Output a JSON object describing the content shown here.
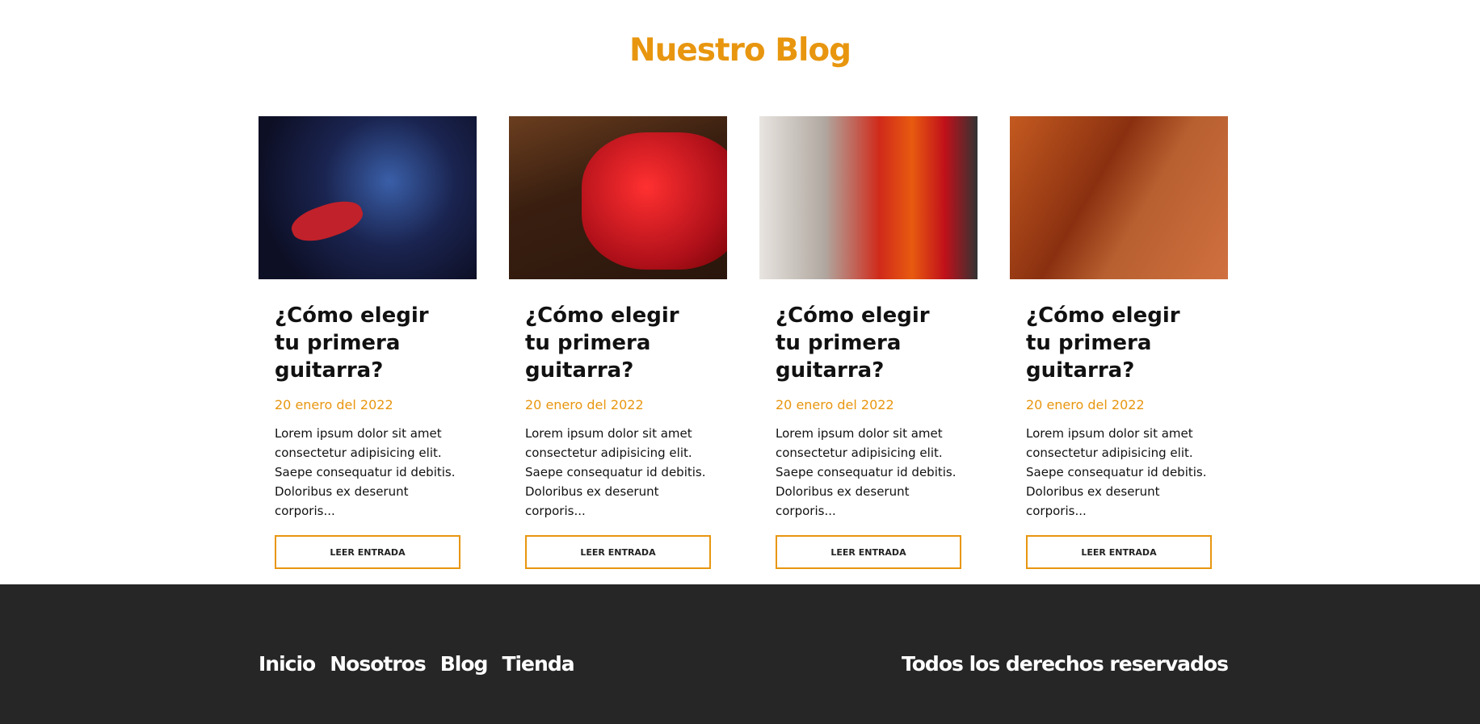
{
  "heading": "Nuestro Blog",
  "posts": [
    {
      "title": "¿Cómo elegir tu primera guitarra?",
      "date": "20 enero del 2022",
      "excerpt": "Lorem ipsum dolor sit amet consectetur adipisicing elit. Saepe consequatur id debitis. Doloribus ex deserunt corporis...",
      "button": "LEER ENTRADA"
    },
    {
      "title": "¿Cómo elegir tu primera guitarra?",
      "date": "20 enero del 2022",
      "excerpt": "Lorem ipsum dolor sit amet consectetur adipisicing elit. Saepe consequatur id debitis. Doloribus ex deserunt corporis...",
      "button": "LEER ENTRADA"
    },
    {
      "title": "¿Cómo elegir tu primera guitarra?",
      "date": "20 enero del 2022",
      "excerpt": "Lorem ipsum dolor sit amet consectetur adipisicing elit. Saepe consequatur id debitis. Doloribus ex deserunt corporis...",
      "button": "LEER ENTRADA"
    },
    {
      "title": "¿Cómo elegir tu primera guitarra?",
      "date": "20 enero del 2022",
      "excerpt": "Lorem ipsum dolor sit amet consectetur adipisicing elit. Saepe consequatur id debitis. Doloribus ex deserunt corporis...",
      "button": "LEER ENTRADA"
    }
  ],
  "footer": {
    "nav": [
      "Inicio",
      "Nosotros",
      "Blog",
      "Tienda"
    ],
    "copyright": "Todos los derechos reservados"
  },
  "colors": {
    "accent": "#e8960f",
    "footer_bg": "#262626"
  }
}
